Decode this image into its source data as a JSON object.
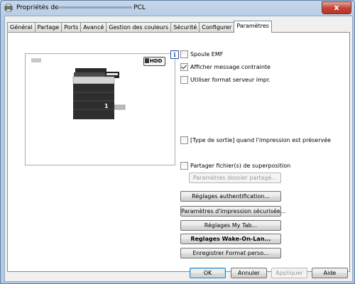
{
  "window": {
    "title_prefix": "Propriétés de ",
    "title_suffix": "PCL",
    "close_label": "x"
  },
  "tabs": [
    "Général",
    "Partage",
    "Ports",
    "Avancé",
    "Gestion des couleurs",
    "Sécurité",
    "Configurer",
    "Paramètres"
  ],
  "active_tab": "Paramètres",
  "preview": {
    "hdd_label": "HDD",
    "tray_number": "1"
  },
  "options": {
    "spool_emf": {
      "label": "Spoule EMF",
      "checked": false
    },
    "show_constraint": {
      "label": "Afficher message contrainte",
      "checked": true
    },
    "server_format": {
      "label": "Utiliser format serveur impr.",
      "checked": false
    },
    "output_type": {
      "label": "[Type de sortie] quand l'impression est préservée",
      "checked": false
    },
    "share_overlay": {
      "label": "Partager fichier(s) de superposition",
      "checked": false
    }
  },
  "buttons": {
    "shared_folder": "Paramètres dossier partagé...",
    "auth": "Réglages authentification...",
    "secure_print": "Paramètres d'impression sécurisée...",
    "my_tab": "Réglages My Tab...",
    "wake_on_lan": "Reglages Wake-On-Lan...",
    "save_custom": "Enregistrer Format perso...",
    "ok": "OK",
    "cancel": "Annuler",
    "apply": "Appliquer",
    "help": "Aide"
  },
  "info_icon_glyph": "i"
}
